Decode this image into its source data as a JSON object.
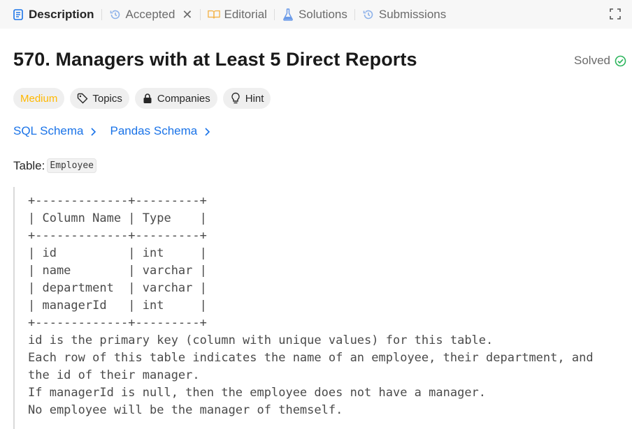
{
  "tabs": [
    {
      "label": "Description",
      "icon": "document-icon",
      "active": true
    },
    {
      "label": "Accepted",
      "icon": "history-icon",
      "closable": true
    },
    {
      "label": "Editorial",
      "icon": "book-icon"
    },
    {
      "label": "Solutions",
      "icon": "flask-icon"
    },
    {
      "label": "Submissions",
      "icon": "history-icon"
    }
  ],
  "header": {
    "title": "570. Managers with at Least 5 Direct Reports",
    "status": "Solved"
  },
  "tags": {
    "difficulty": "Medium",
    "topics": "Topics",
    "companies": "Companies",
    "hint": "Hint"
  },
  "schemas": {
    "sql": "SQL Schema",
    "pandas": "Pandas Schema"
  },
  "table_ref": {
    "prefix": "Table:",
    "name": "Employee"
  },
  "schema_block": {
    "lines": [
      "+-------------+---------+",
      "| Column Name | Type    |",
      "+-------------+---------+",
      "| id          | int     |",
      "| name        | varchar |",
      "| department  | varchar |",
      "| managerId   | int     |",
      "+-------------+---------+",
      "id is the primary key (column with unique values) for this table.",
      "Each row of this table indicates the name of an employee, their department, and",
      "the id of their manager.",
      "If managerId is null, then the employee does not have a manager.",
      "No employee will be the manager of themself."
    ]
  },
  "colors": {
    "medium": "#ffb800",
    "link": "#1a73e8",
    "solved_check": "#2db55d"
  }
}
